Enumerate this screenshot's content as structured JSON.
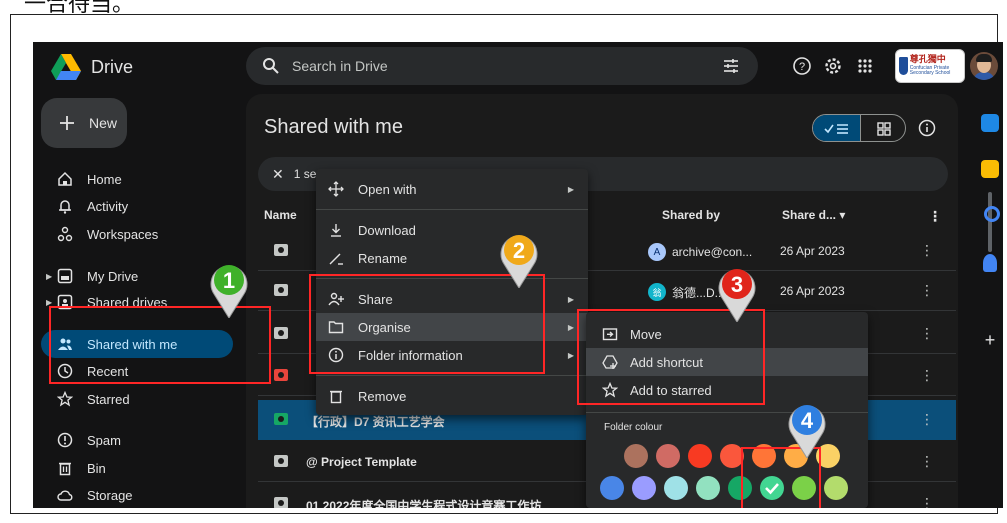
{
  "partial_caption": "一合待当。",
  "app": {
    "name": "Drive"
  },
  "search": {
    "placeholder": "Search in Drive"
  },
  "school_logo": {
    "line1": "尊孔獨中",
    "line2": "Confucian Private Secondary School"
  },
  "new_button": "New",
  "sidebar": {
    "items": [
      {
        "label": "Home",
        "icon": "home-icon"
      },
      {
        "label": "Activity",
        "icon": "bell-icon"
      },
      {
        "label": "Workspaces",
        "icon": "workspaces-icon"
      },
      {
        "label": "My Drive",
        "icon": "my-drive-icon"
      },
      {
        "label": "Shared drives",
        "icon": "shared-drives-icon"
      },
      {
        "label": "Shared with me",
        "icon": "people-icon",
        "active": true
      },
      {
        "label": "Recent",
        "icon": "clock-icon"
      },
      {
        "label": "Starred",
        "icon": "star-icon"
      },
      {
        "label": "Spam",
        "icon": "spam-icon"
      },
      {
        "label": "Bin",
        "icon": "trash-icon"
      },
      {
        "label": "Storage",
        "icon": "cloud-icon"
      }
    ]
  },
  "main": {
    "title": "Shared with me",
    "selection_text": "1 se",
    "columns": {
      "name": "Name",
      "shared_by": "Shared by",
      "share_date": "Share d... ▾"
    },
    "rows": [
      {
        "name": "",
        "shared_by": "archive@con...",
        "badge": "A",
        "date": "26 Apr 2023"
      },
      {
        "name": "",
        "shared_by": "翁德...D...",
        "badge": "翁",
        "date": "26 Apr 2023"
      },
      {
        "name": "",
        "shared_by": "",
        "date": ""
      },
      {
        "name": "",
        "shared_by": "",
        "date": ""
      },
      {
        "name": "【行政】D7 资讯工艺学会",
        "shared_by": "",
        "date": "",
        "highlighted": true
      },
      {
        "name": "@ Project Template",
        "shared_by": "",
        "date": ""
      },
      {
        "name": "01 2022年度全国中学生程式设计竞赛工作坊",
        "shared_by": "",
        "date": ""
      }
    ]
  },
  "context_menu": {
    "items": [
      {
        "label": "Open with",
        "icon": "open-with-icon",
        "has_submenu": true
      },
      {
        "label": "Download",
        "icon": "download-icon"
      },
      {
        "label": "Rename",
        "icon": "rename-icon"
      },
      {
        "label": "Share",
        "icon": "share-icon",
        "has_submenu": true
      },
      {
        "label": "Organise",
        "icon": "folder-icon",
        "has_submenu": true,
        "hover": true
      },
      {
        "label": "Folder information",
        "icon": "info-icon",
        "has_submenu": true
      },
      {
        "label": "Remove",
        "icon": "trash-icon"
      }
    ]
  },
  "organise_menu": {
    "items": [
      {
        "label": "Move",
        "icon": "move-icon"
      },
      {
        "label": "Add shortcut",
        "icon": "add-shortcut-icon",
        "hover": true
      },
      {
        "label": "Add to starred",
        "icon": "star-icon"
      }
    ],
    "folder_colour_label": "Folder colour",
    "colours_row1": [
      "#ac725e",
      "#d06b64",
      "#f83a22",
      "#fa573c",
      "#ff7537",
      "#ffad46",
      "#fad165"
    ],
    "colours_row2": [
      "#4986e7",
      "#9a9cff",
      "#9fe1e7",
      "#92e1c0",
      "#16a765",
      "#42d692",
      "#7bd148",
      "#b3dc6c"
    ],
    "selected_colour_index_row2": 5
  },
  "annotations": {
    "markers": [
      "1",
      "2",
      "3",
      "4"
    ],
    "box_color": "#ff2626"
  },
  "colors": {
    "background": "#131314",
    "active_nav": "#004a77",
    "selected_row": "#0b4f7a",
    "menu_bg": "#28292a"
  }
}
